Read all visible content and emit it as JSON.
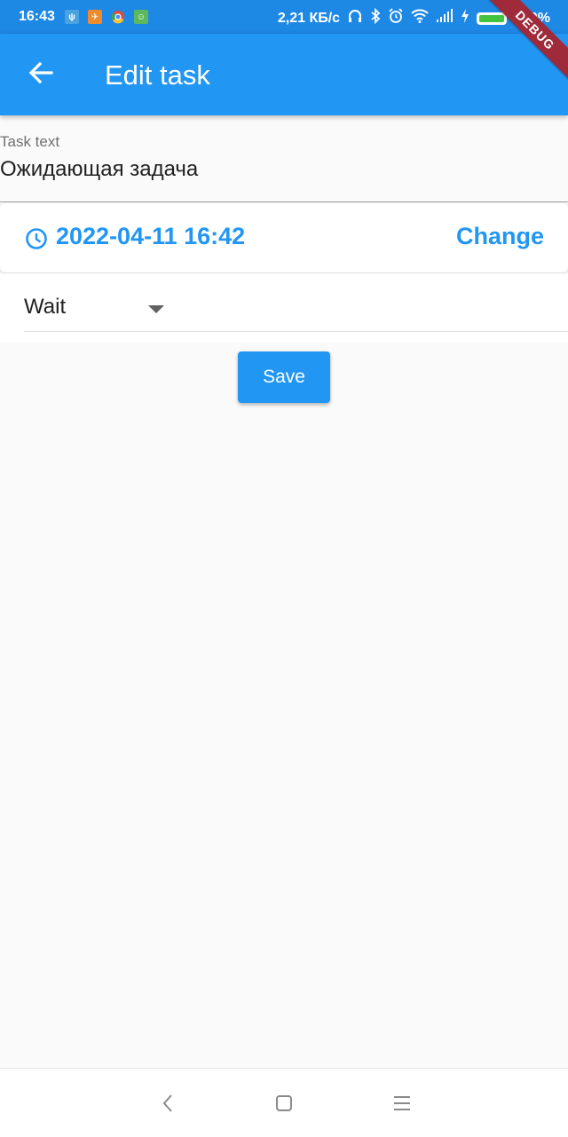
{
  "status_bar": {
    "time": "16:43",
    "speed": "2,21 КБ/с",
    "battery": "100%",
    "left_icons": [
      "sim-icon",
      "notification-icon",
      "chrome-icon",
      "android-icon"
    ],
    "right_icons": [
      "headphones-icon",
      "bluetooth-icon",
      "alarm-icon",
      "wifi-icon",
      "signal-icon",
      "charging-icon",
      "battery-icon"
    ]
  },
  "debug_banner": "DEBUG",
  "app_bar": {
    "title": "Edit task",
    "back_icon": "arrow-back-icon"
  },
  "task_field": {
    "label": "Task text",
    "value": "Ожидающая задача"
  },
  "date_card": {
    "icon": "clock-icon",
    "datetime": "2022-04-11 16:42",
    "change_label": "Change"
  },
  "status_dropdown": {
    "selected": "Wait"
  },
  "save_button": {
    "label": "Save"
  },
  "nav_bar": {
    "icons": [
      "back-nav-icon",
      "home-nav-icon",
      "menu-nav-icon"
    ]
  },
  "colors": {
    "primary": "#2196f3",
    "status_bar": "#1e88e5",
    "background": "#fafafa",
    "debug": "#9e2a3a"
  }
}
